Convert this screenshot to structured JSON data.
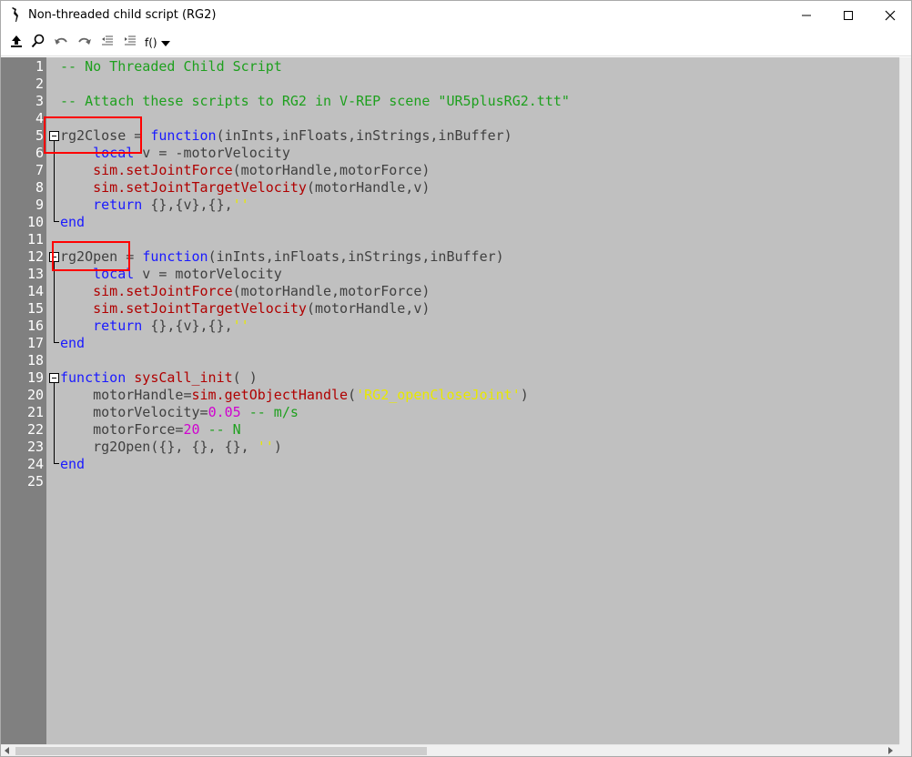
{
  "window": {
    "title": "Non-threaded child script (RG2)"
  },
  "toolbar": {
    "icons": [
      "upload-icon",
      "search-icon",
      "undo-icon",
      "redo-icon",
      "outdent-icon",
      "indent-icon"
    ],
    "functions_label": "f()"
  },
  "editor": {
    "lines": [
      {
        "n": "1",
        "tokens": [
          [
            "com",
            "-- No Threaded Child Script"
          ]
        ]
      },
      {
        "n": "2",
        "tokens": []
      },
      {
        "n": "3",
        "tokens": [
          [
            "com",
            "-- Attach these scripts to RG2 in V-REP scene \"UR5plusRG2.ttt\""
          ]
        ]
      },
      {
        "n": "4",
        "tokens": []
      },
      {
        "n": "5",
        "tokens": [
          [
            "def",
            "rg2Close = "
          ],
          [
            "kw",
            "function"
          ],
          [
            "def",
            "(inInts,inFloats,inStrings,inBuffer)"
          ]
        ]
      },
      {
        "n": "6",
        "tokens": [
          [
            "def",
            "    "
          ],
          [
            "kw",
            "local"
          ],
          [
            "def",
            " v = -motorVelocity"
          ]
        ]
      },
      {
        "n": "7",
        "tokens": [
          [
            "def",
            "    "
          ],
          [
            "api",
            "sim.setJointForce"
          ],
          [
            "def",
            "(motorHandle,motorForce)"
          ]
        ]
      },
      {
        "n": "8",
        "tokens": [
          [
            "def",
            "    "
          ],
          [
            "api",
            "sim.setJointTargetVelocity"
          ],
          [
            "def",
            "(motorHandle,v)"
          ]
        ]
      },
      {
        "n": "9",
        "tokens": [
          [
            "def",
            "    "
          ],
          [
            "kw",
            "return"
          ],
          [
            "def",
            " {},{v},{},"
          ],
          [
            "str",
            "''"
          ]
        ]
      },
      {
        "n": "10",
        "tokens": [
          [
            "kw",
            "end"
          ]
        ]
      },
      {
        "n": "11",
        "tokens": []
      },
      {
        "n": "12",
        "tokens": [
          [
            "def",
            "rg2Open = "
          ],
          [
            "kw",
            "function"
          ],
          [
            "def",
            "(inInts,inFloats,inStrings,inBuffer)"
          ]
        ]
      },
      {
        "n": "13",
        "tokens": [
          [
            "def",
            "    "
          ],
          [
            "kw",
            "local"
          ],
          [
            "def",
            " v = motorVelocity"
          ]
        ]
      },
      {
        "n": "14",
        "tokens": [
          [
            "def",
            "    "
          ],
          [
            "api",
            "sim.setJointForce"
          ],
          [
            "def",
            "(motorHandle,motorForce)"
          ]
        ]
      },
      {
        "n": "15",
        "tokens": [
          [
            "def",
            "    "
          ],
          [
            "api",
            "sim.setJointTargetVelocity"
          ],
          [
            "def",
            "(motorHandle,v)"
          ]
        ]
      },
      {
        "n": "16",
        "tokens": [
          [
            "def",
            "    "
          ],
          [
            "kw",
            "return"
          ],
          [
            "def",
            " {},{v},{},"
          ],
          [
            "str",
            "''"
          ]
        ]
      },
      {
        "n": "17",
        "tokens": [
          [
            "kw",
            "end"
          ]
        ]
      },
      {
        "n": "18",
        "tokens": []
      },
      {
        "n": "19",
        "tokens": [
          [
            "kw",
            "function"
          ],
          [
            "def",
            " "
          ],
          [
            "api",
            "sysCall_init"
          ],
          [
            "def",
            "( )"
          ]
        ]
      },
      {
        "n": "20",
        "tokens": [
          [
            "def",
            "    motorHandle="
          ],
          [
            "api",
            "sim.getObjectHandle"
          ],
          [
            "def",
            "("
          ],
          [
            "str",
            "'RG2_openCloseJoint'"
          ],
          [
            "def",
            ")"
          ]
        ]
      },
      {
        "n": "21",
        "tokens": [
          [
            "def",
            "    motorVelocity="
          ],
          [
            "num",
            "0.05"
          ],
          [
            "def",
            " "
          ],
          [
            "com",
            "-- m/s"
          ]
        ]
      },
      {
        "n": "22",
        "tokens": [
          [
            "def",
            "    motorForce="
          ],
          [
            "num",
            "20"
          ],
          [
            "def",
            " "
          ],
          [
            "com",
            "-- N"
          ]
        ]
      },
      {
        "n": "23",
        "tokens": [
          [
            "def",
            "    rg2Open({}, {}, {}, "
          ],
          [
            "str",
            "''"
          ],
          [
            "def",
            ")"
          ]
        ]
      },
      {
        "n": "24",
        "tokens": [
          [
            "kw",
            "end"
          ]
        ]
      },
      {
        "n": "25",
        "tokens": []
      }
    ]
  },
  "colors": {
    "editor_bg": "#c0c0c0",
    "gutter_bg": "#808080",
    "comment": "#1ea01e",
    "keyword": "#1a1aff",
    "api": "#b00000",
    "number": "#d000d0",
    "string": "#e8e800",
    "highlight_box": "#ff0000"
  }
}
